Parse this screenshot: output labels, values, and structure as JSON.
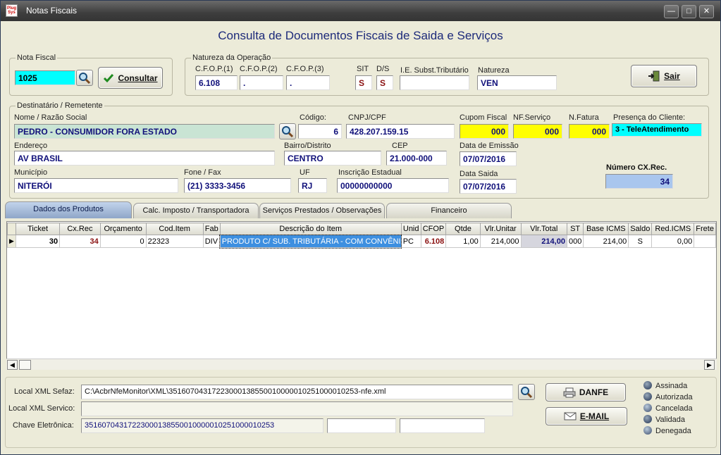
{
  "window": {
    "title": "Notas Fiscais",
    "app_icon_text": "Plug Sys"
  },
  "heading": "Consulta de Documentos Fiscais de Saida e Serviços",
  "nota_fiscal": {
    "group_label": "Nota Fiscal",
    "number": "1025",
    "consultar_label": "Consultar"
  },
  "natureza": {
    "group_label": "Natureza da Operação",
    "cfop1_label": "C.F.O.P.(1)",
    "cfop1": "6.108",
    "cfop2_label": "C.F.O.P.(2)",
    "cfop2": ".",
    "cfop3_label": "C.F.O.P.(3)",
    "cfop3": ".",
    "sit_label": "SIT",
    "sit": "S",
    "ds_label": "D/S",
    "ds": "S",
    "ie_label": "I.E. Subst.Tributário",
    "ie": "",
    "natureza_label": "Natureza",
    "natureza": "VEN",
    "sair_label": "Sair"
  },
  "dest": {
    "group_label": "Destinatário / Remetente",
    "nome_label": "Nome / Razão Social",
    "nome": "PEDRO - CONSUMIDOR FORA ESTADO",
    "codigo_label": "Código:",
    "codigo": "6",
    "cnpj_label": "CNPJ/CPF",
    "cnpj": "428.207.159.15",
    "cupom_label": "Cupom Fiscal",
    "cupom": "000",
    "nfserv_label": "NF.Serviço",
    "nfserv": "000",
    "nfatura_label": "N.Fatura",
    "nfatura": "000",
    "presenca_label": "Presença do Cliente:",
    "presenca": "3 - TeleAtendimento",
    "endereco_label": "Endereço",
    "endereco": "AV BRASIL",
    "bairro_label": "Bairro/Distrito",
    "bairro": "CENTRO",
    "cep_label": "CEP",
    "cep": "21.000-000",
    "emissao_label": "Data de Emissão",
    "emissao": "07/07/2016",
    "municipio_label": "Município",
    "municipio": "NITERÓI",
    "fone_label": "Fone / Fax",
    "fone": "(21) 3333-3456",
    "uf_label": "UF",
    "uf": "RJ",
    "ie_label": "Inscrição Estadual",
    "ie": "00000000000",
    "saida_label": "Data Saida",
    "saida": "07/07/2016",
    "cx_label": "Número CX.Rec.",
    "cx": "34"
  },
  "tabs": [
    "Dados dos Produtos",
    "Calc. Imposto / Transportadora",
    "Serviços Prestados / Observações",
    "Financeiro"
  ],
  "grid": {
    "columns": [
      "Ticket",
      "Cx.Rec",
      "Orçamento",
      "Cod.Item",
      "Fab",
      "Descrição do Item",
      "Unid",
      "CFOP",
      "Qtde",
      "Vlr.Unitar",
      "Vlr.Total",
      "ST",
      "Base ICMS",
      "Saldo",
      "Red.ICMS",
      "Frete"
    ],
    "row": {
      "ticket": "30",
      "cxrec": "34",
      "orcamento": "0",
      "coditem": "22323",
      "fab": "DIV",
      "descricao": "PRODUTO C/ SUB. TRIBUTÁRIA - COM CONVÊNIO",
      "unid": "PC",
      "cfop": "6.108",
      "qtde": "1,00",
      "vlrunit": "214,000",
      "vlrtotal": "214,00",
      "st": "000",
      "base": "214,00",
      "saldo": "S",
      "redicms": "0,00",
      "frete": ""
    }
  },
  "bottom": {
    "xml_sefaz_label": "Local XML Sefaz:",
    "xml_sefaz": "C:\\AcbrNfeMonitor\\XML\\35160704317223000138550010000010251000010253-nfe.xml",
    "xml_servico_label": "Local XML Servico:",
    "xml_servico": "",
    "chave_label": "Chave Eletrônica:",
    "chave": "35160704317223000138550010000010251000010253",
    "danfe_label": "DANFE",
    "email_label": "E-MAIL"
  },
  "status": [
    "Assinada",
    "Autorizada",
    "Cancelada",
    "Validada",
    "Denegada"
  ],
  "colors": {
    "highlight_cyan": "#00ffff",
    "highlight_yellow": "#ffff00",
    "selected": "#3d8fe0",
    "cx_box": "#a9c6ee"
  }
}
